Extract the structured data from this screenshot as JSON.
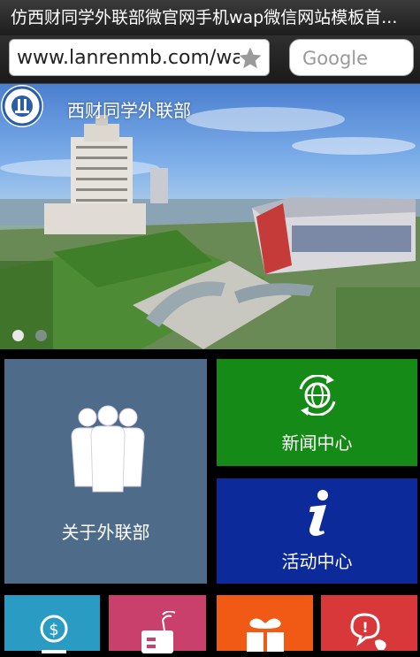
{
  "window": {
    "title": "仿西财同学外联部微官网手机wap微信网站模板首..."
  },
  "address_bar": {
    "url": "www.lanrenmb.com/wap",
    "search_placeholder": "Google"
  },
  "banner": {
    "title": "西财同学外联部",
    "slide_count": 2,
    "active_slide": 1
  },
  "tiles": [
    {
      "label": "关于外联部",
      "color": "#4f6b8a",
      "icon": "people-icon"
    },
    {
      "label": "新闻中心",
      "color": "#168a16",
      "icon": "globe-refresh-icon"
    },
    {
      "label": "活动中心",
      "color": "#0d2a9a",
      "icon": "info-icon"
    },
    {
      "label": "",
      "color": "#2a9cc4",
      "icon": "money-icon"
    },
    {
      "label": "",
      "color": "#c9406d",
      "icon": "radio-icon"
    },
    {
      "label": "",
      "color": "#f05a14",
      "icon": "gift-icon"
    },
    {
      "label": "",
      "color": "#d8383a",
      "icon": "help-phone-icon"
    }
  ]
}
